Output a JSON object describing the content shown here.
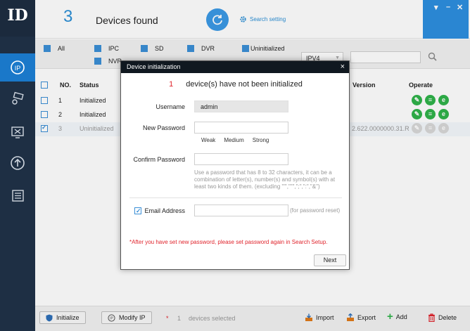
{
  "app": {
    "logo": "ID"
  },
  "header": {
    "device_count": "3",
    "devices_found": "Devices found",
    "search_setting": "Search setting"
  },
  "filters": {
    "items": [
      {
        "label": "All",
        "checked": true
      },
      {
        "label": "IPC",
        "checked": true
      },
      {
        "label": "SD",
        "checked": true
      },
      {
        "label": "DVR",
        "checked": true
      },
      {
        "label": "Uninitialized",
        "checked": true
      },
      {
        "label": "NVR",
        "checked": true
      }
    ],
    "ip_version": "IPV4",
    "search_value": ""
  },
  "table": {
    "columns": [
      "NO.",
      "Status",
      "Version",
      "Operate"
    ],
    "rows": [
      {
        "no": "1",
        "status": "Initialized",
        "version": "",
        "checked": false
      },
      {
        "no": "2",
        "status": "Initialized",
        "version": "",
        "checked": false
      },
      {
        "no": "3",
        "status": "Uninitialized",
        "version": "2.622.0000000.31.R",
        "checked": true
      }
    ]
  },
  "dialog": {
    "title": "Device initialization",
    "close": "×",
    "count": "1",
    "message": "device(s) have not been initialized",
    "username_label": "Username",
    "username_value": "admin",
    "new_password_label": "New Password",
    "strength": [
      "Weak",
      "Medium",
      "Strong"
    ],
    "confirm_password_label": "Confirm Password",
    "hint": "Use a password that has 8 to 32 characters, it can be a combination of letter(s), number(s) and symbol(s) with at least two kinds of them. (excluding \"'\",\"\"\",\";\",\":\",\"&\")",
    "email_label": "Email Address",
    "email_checked": true,
    "email_hint": "(for password reset)",
    "warning": "*After you have set new password, please set password again in Search Setup.",
    "next": "Next"
  },
  "bottombar": {
    "initialize": "Initialize",
    "modify_ip": "Modify IP",
    "selected_star": "*",
    "selected_count": "1",
    "selected_text": "devices selected",
    "import": "Import",
    "export": "Export",
    "add": "Add",
    "delete": "Delete"
  },
  "colors": {
    "accent": "#2d8fe0",
    "sidebar": "#1e2f44",
    "green": "#2fb34a",
    "red": "#e0242c"
  }
}
